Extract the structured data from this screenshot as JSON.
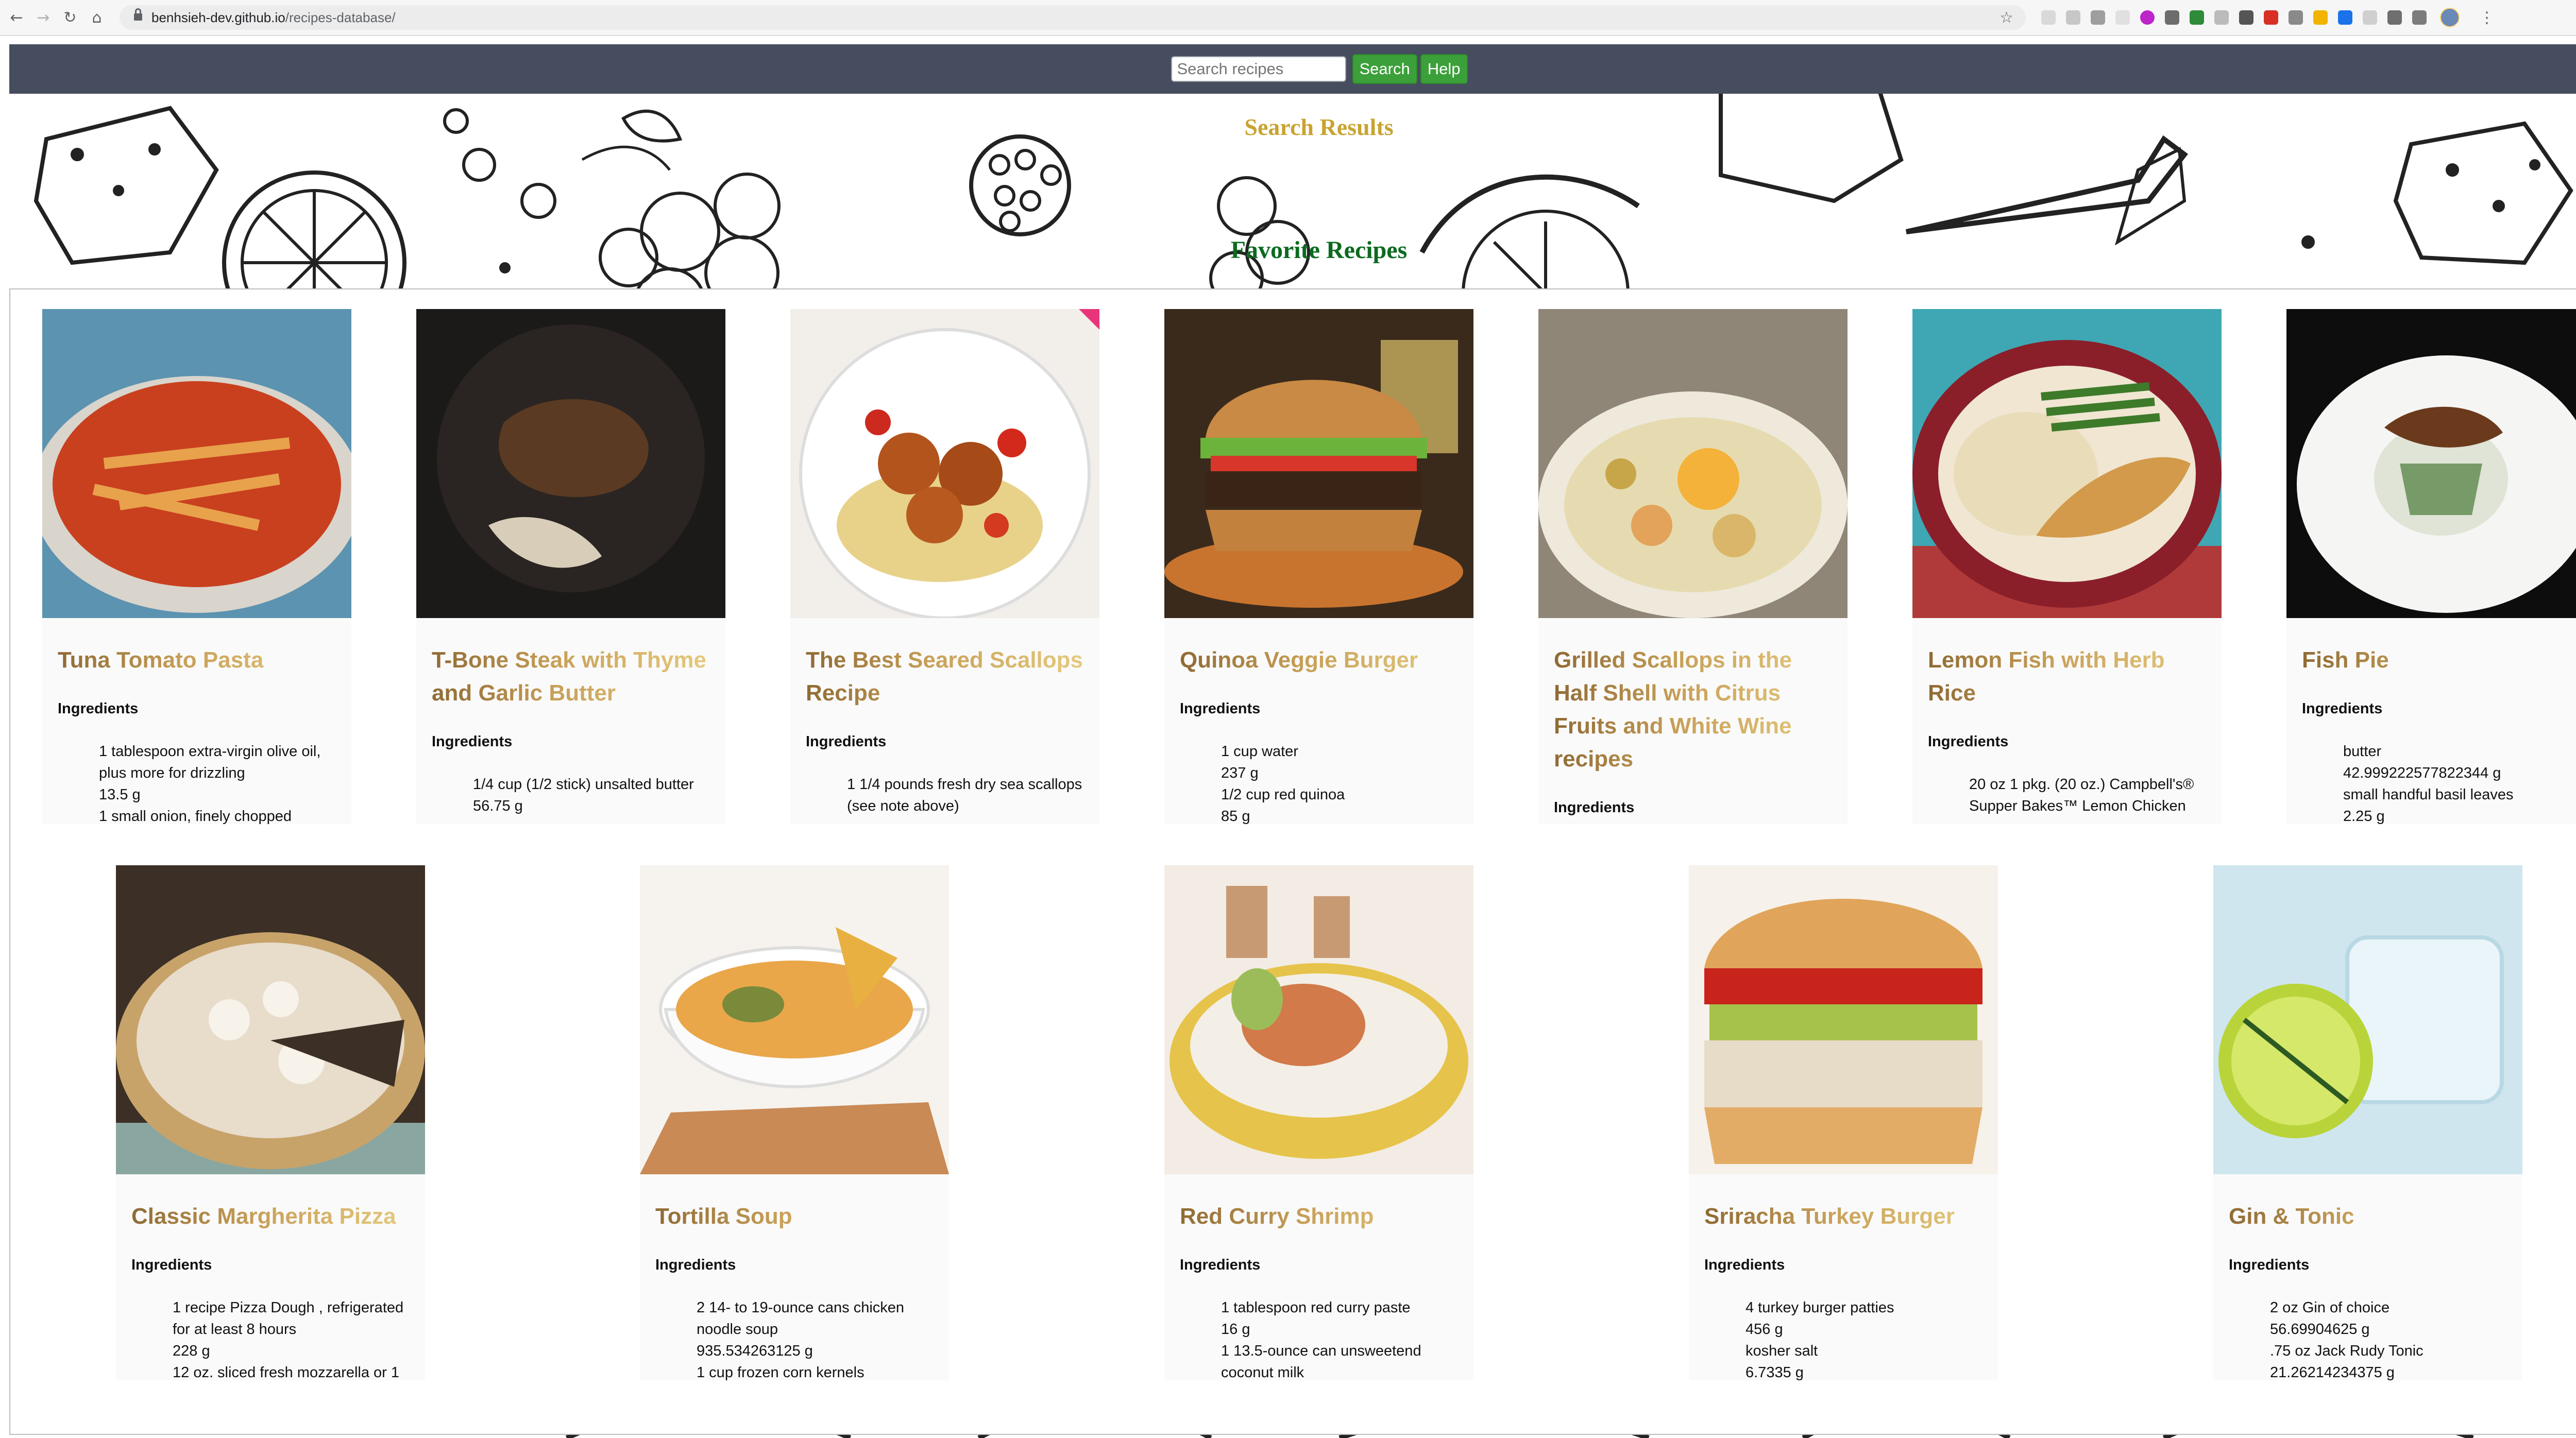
{
  "browser": {
    "url_host": "benhsieh-dev.github.io",
    "url_path": "/recipes-database/"
  },
  "header": {
    "search_placeholder": "Search recipes",
    "search_button": "Search",
    "help_button": "Help"
  },
  "sections": {
    "search_results": "Search Results",
    "favorites": "Favorite Recipes"
  },
  "ingredients_label": "Ingredients",
  "recipes": [
    {
      "title": "Tuna Tomato Pasta",
      "ingredients": [
        "1 tablespoon extra-virgin olive oil, plus more for drizzling",
        "13.5 g",
        "1 small onion, finely chopped"
      ]
    },
    {
      "title": "T-Bone Steak with Thyme and Garlic Butter",
      "ingredients": [
        "1/4 cup (1/2 stick) unsalted butter",
        "56.75 g"
      ]
    },
    {
      "title": "The Best Seared Scallops Recipe",
      "ingredients": [
        "1 1/4 pounds fresh dry sea scallops (see note above)"
      ]
    },
    {
      "title": "Quinoa Veggie Burger",
      "ingredients": [
        "1 cup water",
        "237 g",
        "1/2 cup red quinoa",
        "85 g"
      ]
    },
    {
      "title": "Grilled Scallops in the Half Shell with Citrus Fruits and White Wine recipes",
      "ingredients": []
    },
    {
      "title": "Lemon Fish with Herb Rice",
      "ingredients": [
        "20 oz 1 pkg. (20 oz.) Campbell's® Supper Bakes™ Lemon Chicken"
      ]
    },
    {
      "title": "Fish Pie",
      "ingredients": [
        "butter",
        "42.999222577822344 g",
        "small handful basil leaves",
        "2.25 g"
      ]
    },
    {
      "title": "Classic Margherita Pizza",
      "ingredients": [
        "1 recipe Pizza Dough , refrigerated for at least 8 hours",
        "228 g",
        "12 oz. sliced fresh mozzarella or 1"
      ]
    },
    {
      "title": "Tortilla Soup",
      "ingredients": [
        "2 14- to 19-ounce cans chicken noodle soup",
        "935.534263125 g",
        "1 cup frozen corn kernels"
      ]
    },
    {
      "title": "Red Curry Shrimp",
      "ingredients": [
        "1 tablespoon red curry paste",
        "16 g",
        "1 13.5-ounce can unsweetend coconut milk"
      ]
    },
    {
      "title": "Sriracha Turkey Burger",
      "ingredients": [
        "4 turkey burger patties",
        "456 g",
        "kosher salt",
        "6.7335 g"
      ]
    },
    {
      "title": "Gin & Tonic",
      "ingredients": [
        "2 oz Gin of choice",
        "56.69904625 g",
        ".75 oz Jack Rudy Tonic",
        "21.26214234375 g"
      ]
    }
  ]
}
